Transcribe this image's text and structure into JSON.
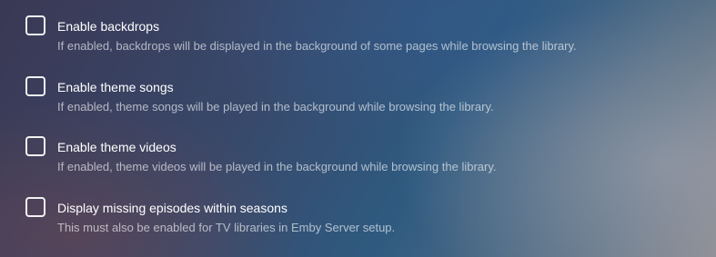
{
  "settings": [
    {
      "label": "Enable backdrops",
      "description": "If enabled, backdrops will be displayed in the background of some pages while browsing the library.",
      "checked": false
    },
    {
      "label": "Enable theme songs",
      "description": "If enabled, theme songs will be played in the background while browsing the library.",
      "checked": false
    },
    {
      "label": "Enable theme videos",
      "description": "If enabled, theme videos will be played in the background while browsing the library.",
      "checked": false
    },
    {
      "label": "Display missing episodes within seasons",
      "description": "This must also be enabled for TV libraries in Emby Server setup.",
      "checked": false
    }
  ]
}
